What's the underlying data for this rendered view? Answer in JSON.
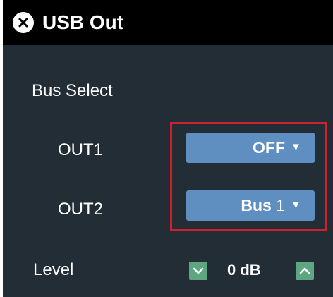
{
  "window": {
    "title": "USB Out",
    "close_icon": "close-circle-icon"
  },
  "bus_select": {
    "label": "Bus Select",
    "outputs": [
      {
        "label": "OUT1",
        "value": "OFF",
        "value_bold": "OFF",
        "value_num": ""
      },
      {
        "label": "OUT2",
        "value": "Bus 1",
        "value_bold": "Bus",
        "value_num": " 1"
      }
    ],
    "dropdown_icon": "triangle-down-icon"
  },
  "level": {
    "label": "Level",
    "value": "0 dB",
    "decrease_icon": "chevron-down-icon",
    "increase_icon": "chevron-up-icon"
  },
  "colors": {
    "background": "#232d36",
    "titlebar": "#000000",
    "dropdown": "#5f8fc0",
    "stepper": "#5ea582",
    "highlight": "#d11f2d"
  }
}
